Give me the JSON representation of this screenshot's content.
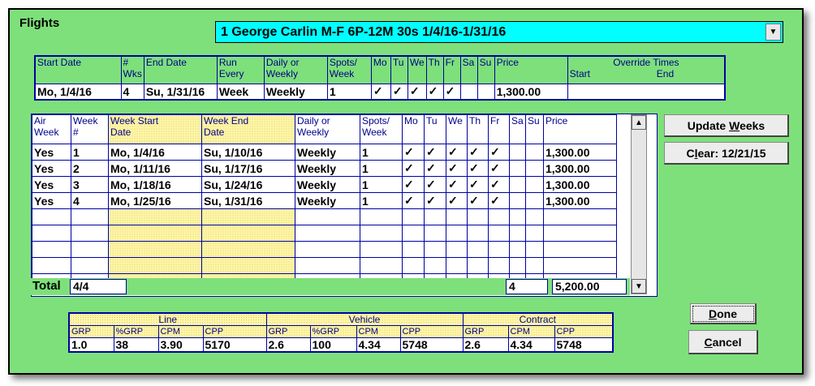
{
  "title": "Flights",
  "flight_selector": {
    "value": "1 George Carlin M-F 6P-12M 30s 1/4/16-1/31/16"
  },
  "flight_header": {
    "cols": [
      "Start Date",
      "#\nWks",
      "End Date",
      "Run\nEvery",
      "Daily or\nWeekly",
      "Spots/\nWeek",
      "Mo",
      "Tu",
      "We",
      "Th",
      "Fr",
      "Sa",
      "Su",
      "Price",
      "Override Times"
    ],
    "override_start": "Start",
    "override_end": "End",
    "values": {
      "start_date": "Mo, 1/4/16",
      "wks": "4",
      "end_date": "Su, 1/31/16",
      "run_every": "Week",
      "daily_weekly": "Weekly",
      "spots": "1",
      "days": [
        "✓",
        "✓",
        "✓",
        "✓",
        "✓",
        "",
        ""
      ],
      "price": "1,300.00"
    }
  },
  "weeks": {
    "cols": [
      "Air\nWeek",
      "Week\n#",
      "Week Start\nDate",
      "Week End\nDate",
      "Daily or\nWeekly",
      "Spots/\nWeek",
      "Mo",
      "Tu",
      "We",
      "Th",
      "Fr",
      "Sa",
      "Su",
      "Price"
    ],
    "rows": [
      {
        "air": "Yes",
        "num": "1",
        "start": "Mo, 1/4/16",
        "end": "Su, 1/10/16",
        "dw": "Weekly",
        "spots": "1",
        "days": [
          "✓",
          "✓",
          "✓",
          "✓",
          "✓",
          "",
          ""
        ],
        "price": "1,300.00"
      },
      {
        "air": "Yes",
        "num": "2",
        "start": "Mo, 1/11/16",
        "end": "Su, 1/17/16",
        "dw": "Weekly",
        "spots": "1",
        "days": [
          "✓",
          "✓",
          "✓",
          "✓",
          "✓",
          "",
          ""
        ],
        "price": "1,300.00"
      },
      {
        "air": "Yes",
        "num": "3",
        "start": "Mo, 1/18/16",
        "end": "Su, 1/24/16",
        "dw": "Weekly",
        "spots": "1",
        "days": [
          "✓",
          "✓",
          "✓",
          "✓",
          "✓",
          "",
          ""
        ],
        "price": "1,300.00"
      },
      {
        "air": "Yes",
        "num": "4",
        "start": "Mo, 1/25/16",
        "end": "Su, 1/31/16",
        "dw": "Weekly",
        "spots": "1",
        "days": [
          "✓",
          "✓",
          "✓",
          "✓",
          "✓",
          "",
          ""
        ],
        "price": "1,300.00"
      }
    ],
    "empty_rows": 5,
    "total_label": "Total",
    "total_weeks": "4/4",
    "total_spots": "4",
    "total_price": "5,200.00"
  },
  "buttons": {
    "update_weeks_pre": "Update ",
    "update_weeks_key": "W",
    "update_weeks_post": "eeks",
    "clear_pre": "C",
    "clear_key": "l",
    "clear_post": "ear: 12/21/15",
    "done_key": "D",
    "done_post": "one",
    "cancel_key": "C",
    "cancel_post": "ancel"
  },
  "summary": {
    "groups": [
      {
        "name": "Line",
        "labels": [
          "GRP",
          "%GRP",
          "CPM",
          "CPP"
        ],
        "values": [
          "1.0",
          "38",
          "3.90",
          "5170"
        ]
      },
      {
        "name": "Vehicle",
        "labels": [
          "GRP",
          "%GRP",
          "CPM",
          "CPP"
        ],
        "values": [
          "2.6",
          "100",
          "4.34",
          "5748"
        ]
      },
      {
        "name": "Contract",
        "labels": [
          "GRP",
          "CPM",
          "CPP"
        ],
        "values": [
          "2.6",
          "4.34",
          "5748"
        ]
      }
    ]
  },
  "colors": {
    "window_bg": "#7ee07a",
    "combo_bg": "#00ffff",
    "header_text": "#00008b",
    "grid": "#0000a0",
    "dotted_fill": "#fff6a8"
  },
  "icons": {
    "dropdown": "chevron-down-icon",
    "scroll_up": "arrow-up-icon",
    "scroll_down": "arrow-down-icon",
    "check": "checkmark-icon"
  }
}
